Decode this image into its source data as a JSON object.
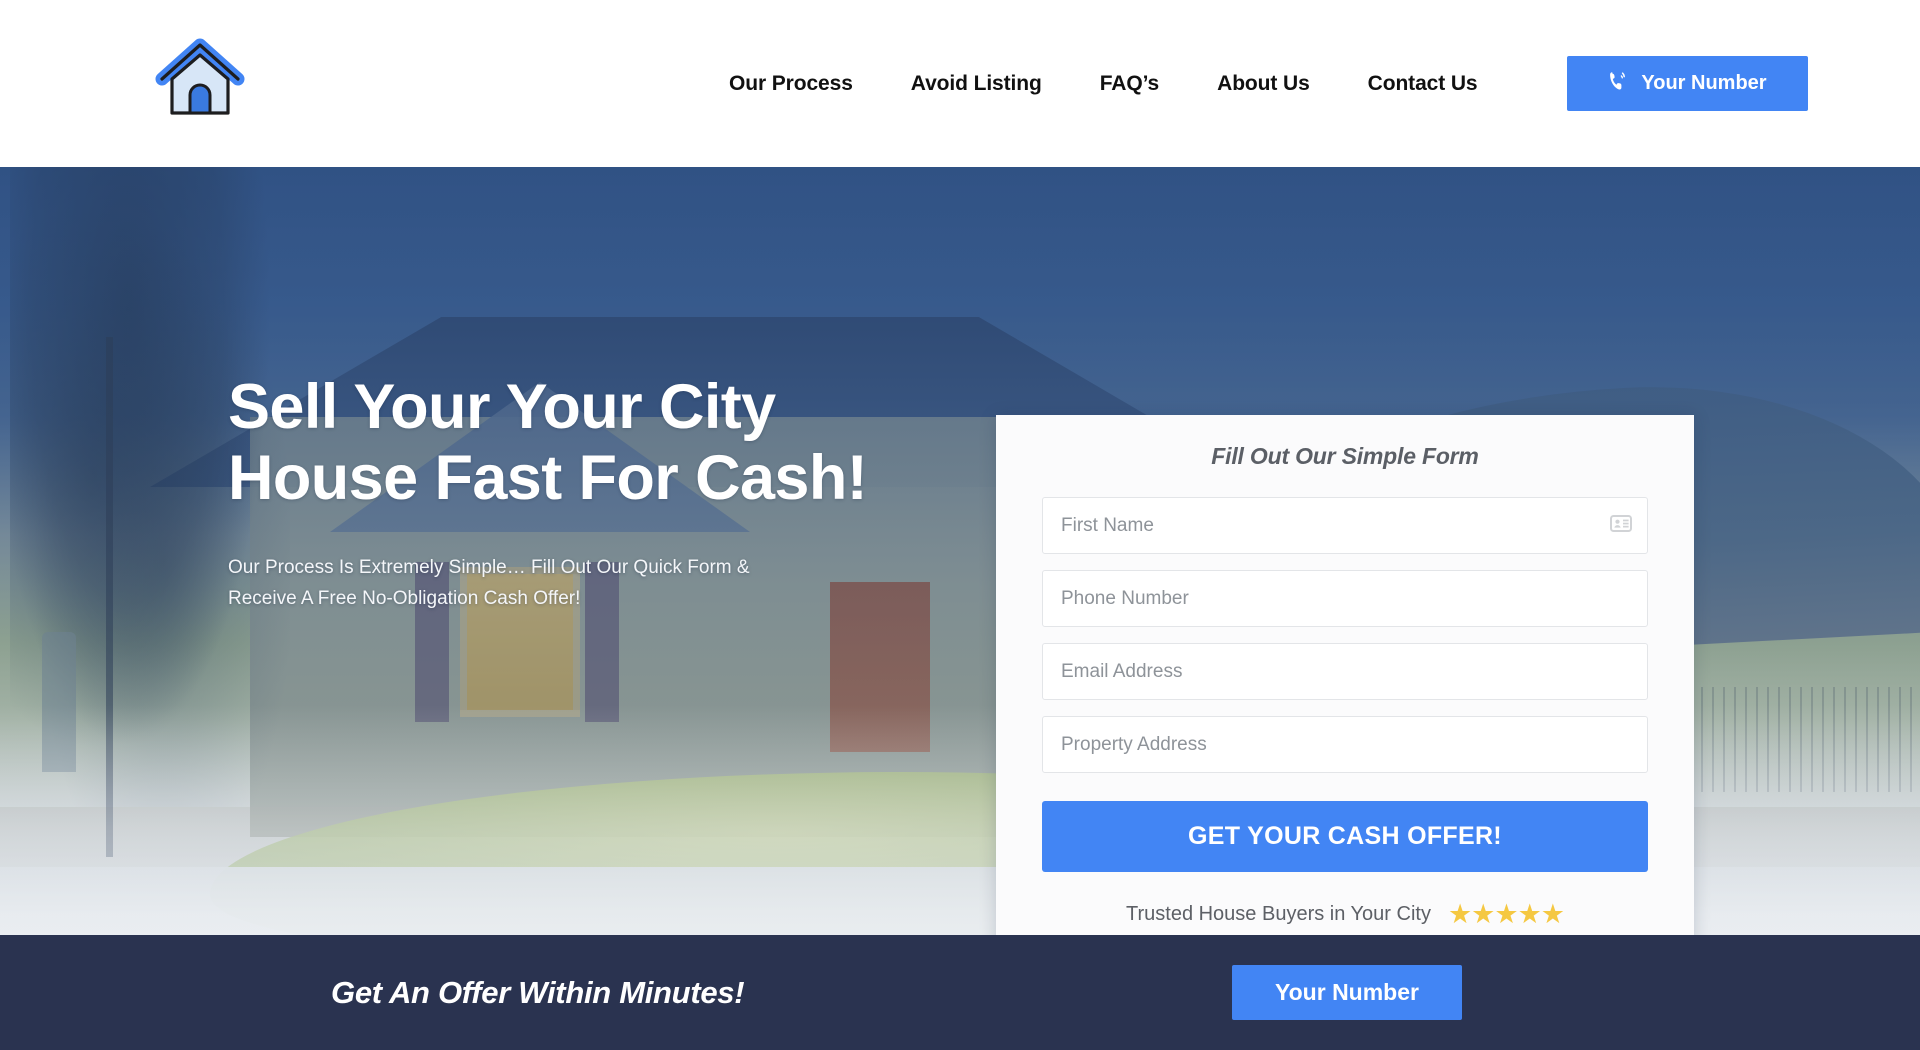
{
  "header": {
    "logo": {
      "icon": "house-logo-icon",
      "roof_color": "#4285f4",
      "body_color": "#d7e6f7",
      "door_color": "#3a7ae0",
      "outline_color": "#1d1d1f"
    },
    "nav": [
      {
        "label": "Our Process"
      },
      {
        "label": "Avoid Listing"
      },
      {
        "label": "FAQ’s"
      },
      {
        "label": "About Us"
      },
      {
        "label": "Contact Us"
      }
    ],
    "cta": {
      "label": "Your Number",
      "icon": "phone-icon",
      "bg_color": "#4285f4",
      "text_color": "#ffffff"
    }
  },
  "hero": {
    "title": "Sell Your Your City House Fast For Cash!",
    "subtitle": "Our Process Is Extremely Simple… Fill Out Our Quick Form & Receive A Free No-Obligation Cash Offer!",
    "overlay_color": "#2a4a7c",
    "title_color": "#ffffff"
  },
  "form": {
    "title": "Fill Out Our Simple Form",
    "fields": [
      {
        "name": "first-name",
        "placeholder": "First Name",
        "value": "",
        "icon": "contact-card-icon"
      },
      {
        "name": "phone-number",
        "placeholder": "Phone Number",
        "value": "",
        "icon": ""
      },
      {
        "name": "email-address",
        "placeholder": "Email Address",
        "value": "",
        "icon": ""
      },
      {
        "name": "property-address",
        "placeholder": "Property Address",
        "value": "",
        "icon": ""
      }
    ],
    "submit_label": "GET YOUR CASH OFFER!",
    "submit_color": "#4285f4",
    "trust_text": "Trusted House Buyers in Your City",
    "stars": "★★★★★",
    "star_count": 5,
    "star_color": "#f5c842",
    "card_bg": "#fbfbfc"
  },
  "bottom_bar": {
    "text": "Get An Offer Within Minutes!",
    "cta_label": "Your Number",
    "bg_color": "#2a3350",
    "cta_color": "#4285f4"
  }
}
